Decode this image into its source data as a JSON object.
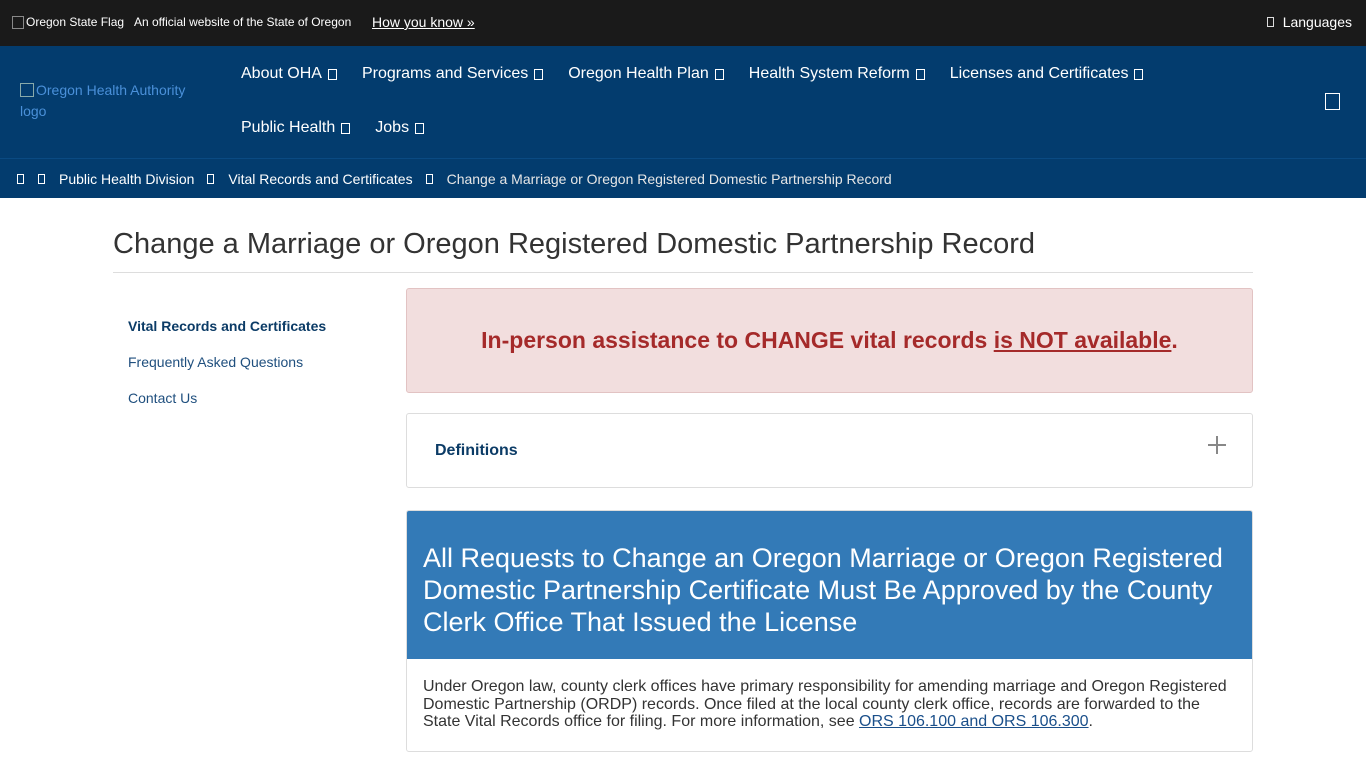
{
  "topbar": {
    "flag_alt": "Oregon State Flag",
    "official_text": "An official website of the State of Oregon",
    "how_you_know": "How you know »",
    "languages": "Languages"
  },
  "nav": {
    "logo_alt": "Oregon Health Authority logo",
    "items_row1": [
      {
        "label": "About OHA"
      },
      {
        "label": "Programs and Services"
      },
      {
        "label": "Oregon Health Plan"
      },
      {
        "label": "Health System Reform"
      },
      {
        "label": "Licenses and Certificates"
      }
    ],
    "items_row2": [
      {
        "label": "Public Health"
      },
      {
        "label": "Jobs"
      }
    ]
  },
  "breadcrumb": {
    "items": [
      {
        "label": "Public Health Division"
      },
      {
        "label": "Vital Records and Certificates"
      },
      {
        "label": "Change a Marriage or Oregon Registered Domestic Partnership Record"
      }
    ]
  },
  "page": {
    "title": "Change a Marriage or Oregon Registered Domestic Partnership Record"
  },
  "sidebar": {
    "items": [
      {
        "label": "Vital Records and Certificates"
      },
      {
        "label": "Frequently Asked Questions"
      },
      {
        "label": "Contact Us"
      }
    ]
  },
  "alert": {
    "text_before": "In-person assistance to CHANGE vital records ",
    "text_link": "is NOT available",
    "text_after": "."
  },
  "definitions": {
    "label": "Definitions"
  },
  "panel": {
    "heading": "All Requests to Change an Oregon Marriage or Oregon Registered Domestic Partnership Certificate Must Be Approved by the County Clerk Office That Issued the License",
    "body_text": "Under Oregon law, county clerk offices have primary responsibility for amending marriage and Oregon Registered Domestic Partnership (ORDP) records. Once filed at the local county clerk office, records are forwarded to the State Vital Records office for filing. For more information, see ",
    "body_link": "ORS 106.100 and ORS 106.300",
    "body_end": "."
  }
}
